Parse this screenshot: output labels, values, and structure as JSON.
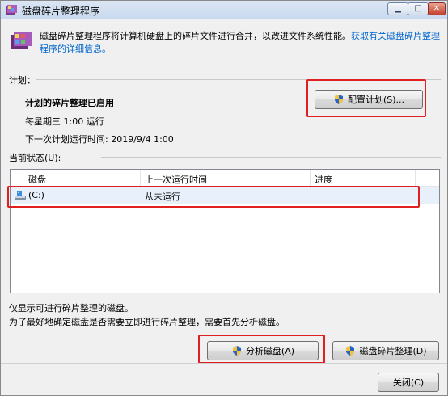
{
  "window": {
    "title": "磁盘碎片整理程序"
  },
  "intro": {
    "text": "磁盘碎片整理程序将计算机硬盘上的碎片文件进行合并，以改进文件系统性能。",
    "link": "获取有关磁盘碎片整理程序的详细信息。"
  },
  "schedule": {
    "label": "计划：",
    "status": "计划的碎片整理已启用",
    "frequency": "每星期三  1:00 运行",
    "next_run": "下一次计划运行时间: 2019/9/4 1:00",
    "configure_button": "配置计划(S)..."
  },
  "current_status": {
    "label": "当前状态(U):",
    "columns": [
      "磁盘",
      "上一次运行时间",
      "进度"
    ],
    "rows": [
      {
        "disk": "(C:)",
        "last_run": "从未运行",
        "progress": ""
      }
    ]
  },
  "notes": {
    "line1": "仅显示可进行碎片整理的磁盘。",
    "line2": "为了最好地确定磁盘是否需要立即进行碎片整理，需要首先分析磁盘。"
  },
  "actions": {
    "analyze_button": "分析磁盘(A)",
    "defrag_button": "磁盘碎片整理(D)",
    "close_button": "关闭(C)"
  },
  "colors": {
    "highlight_box": "#e02020",
    "link": "#0066cc"
  }
}
